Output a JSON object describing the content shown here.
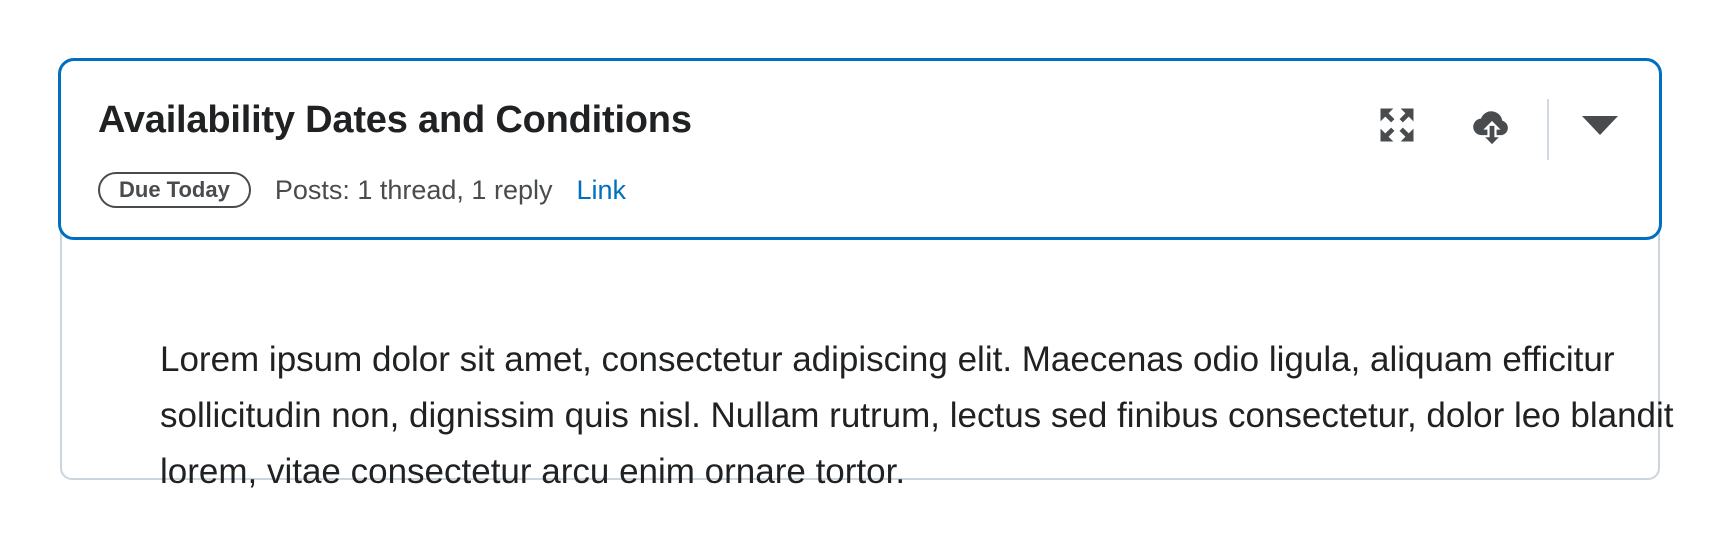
{
  "card": {
    "title": "Availability Dates and Conditions",
    "badge": "Due Today",
    "posts": "Posts: 1 thread, 1 reply",
    "link_label": "Link",
    "actions": {
      "expand_icon": "expand-arrows-icon",
      "upload_icon": "cloud-upload-icon",
      "toggle_icon": "caret-down-icon"
    },
    "body_text": "Lorem ipsum dolor sit amet, consectetur adipiscing elit. Maecenas odio ligula, aliquam efficitur sollicitudin non, dignissim quis nisl. Nullam rutrum, lectus sed finibus consectetur, dolor leo blandit lorem, vitae consectetur arcu enim ornare tortor."
  },
  "colors": {
    "accent": "#006fbf",
    "text": "#202122",
    "muted_text": "#494c4e",
    "border": "#cdd5dc"
  }
}
